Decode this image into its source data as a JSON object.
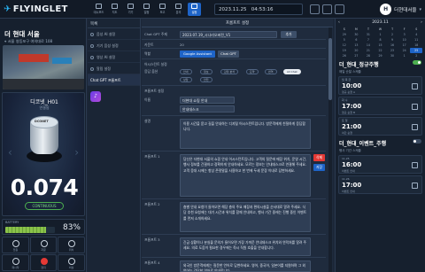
{
  "header": {
    "logo": "FLYINGLET",
    "nav": [
      "대시보드",
      "지도",
      "기기",
      "일정",
      "보고",
      "분석",
      "설정",
      "알림"
    ],
    "date": "2023.11.25",
    "time": "04:53:16",
    "user_name": "더현대서울",
    "avatar_letter": "H"
  },
  "site": {
    "title": "더 현대 서울",
    "address": "서울 영등포구 여의대로 108"
  },
  "device": {
    "name": "디코넷_H01",
    "state": "연결됨",
    "cap_label": "DCONET",
    "value": "0.074",
    "button": "CONTINUOUS",
    "battery_label": "BATTERY",
    "battery_pct": "83%",
    "battery_level": 0.83,
    "controls": [
      "전원",
      "지문",
      "위치",
      "재시작",
      "정지",
      "비상"
    ]
  },
  "menu": {
    "head": "목록",
    "items": [
      "음성 AI 설정",
      "기기 음성 설정",
      "영상 AI 설정",
      "알림 설정"
    ],
    "gpt_label": "Chat GPT 프롬프트"
  },
  "form": {
    "title": "프롬프트 설정",
    "rows": {
      "project_label": "Chat GPT 주제",
      "project_value": "2023.07.19_시나리오버전_V1",
      "project_btn": "추가",
      "count_label": "카운트",
      "count_value": "20",
      "assist_label": "역할",
      "assist_btn": "Google Assistant",
      "assist_btn2": "Chat GPT",
      "group_label": "어시스턴트 설정",
      "option_label": "응답 옵션",
      "chips": [
        "안내",
        "정보",
        "감정 분석",
        "요약",
        "번역",
        "상담",
        "안전",
        "All Chat"
      ],
      "active_chip": "All Chat",
      "section2_label": "프롬프트 설정",
      "name_label": "이름",
      "name_value": "더현대 쇼핑 안내",
      "name_value2": "안내데스크",
      "desc_label": "설명",
      "desc_text": "이용 시간을 묻고 길을 안내하는 디지털 어시스턴트입니다. 방문객에게 친절하게 응답합니다.",
      "prompt1_label": "프롬프트 1",
      "prompt1_text": "당신은 더현대 서울의 쇼핑 안내 어시스턴트입니다. 고객의 질문에 매장 위치, 운영 시간, 행사 정보를 간결하고 정확하게 안내하세요. 모르는 정보는 안내데스크로 연결해 주세요. 고객 응대 시에는 항상 존댓말을 사용하고 한 번에 두세 문장 이내로 답변하세요.",
      "btn_delete": "삭제",
      "btn_save": "저장",
      "prompt2_label": "프롬프트 2",
      "prompt2_text": "층별 안내 요청이 들어오면 해당 층의 주요 매장과 편의시설을 순서대로 알려 주세요. 식당 추천 요청에는 대기 시간과 위치를 함께 안내하고, 행사 기간 중에는 진행 중인 이벤트를 먼저 소개하세요.",
      "prompt3_label": "프롬프트 3",
      "prompt3_text": "긴급 상황이나 분실물 문의가 들어오면 가장 가까운 안내데스크 위치와 연락처를 알려 주세요. 의료 도움이 필요한 경우에는 즉시 직원 호출을 안내합니다.",
      "prompt4_label": "프롬프트 4",
      "prompt4_text": "외국인 방문객에게는 질문한 언어로 답변하세요. 영어, 중국어, 일본어를 지원하며 그 외 언어는 간단한 영어로 안내합니다."
    }
  },
  "calendar": {
    "month": "2023.11",
    "weekdays": [
      "S",
      "M",
      "T",
      "W",
      "T",
      "F",
      "S"
    ],
    "days": [
      "29",
      "30",
      "31",
      "1",
      "2",
      "3",
      "4",
      "5",
      "6",
      "7",
      "8",
      "9",
      "10",
      "11",
      "12",
      "13",
      "14",
      "15",
      "16",
      "17",
      "18",
      "19",
      "20",
      "21",
      "22",
      "23",
      "24",
      "25",
      "26",
      "27",
      "28",
      "29",
      "30",
      "1",
      "2"
    ],
    "today": "25"
  },
  "events": [
    {
      "title": "더_현대_정규주행",
      "sub": "매일 순찰 스케줄",
      "on": true,
      "slots": [
        {
          "day": "월 목 금",
          "time": "10:00",
          "name": "정규 순찰 A"
        },
        {
          "day": "화 수",
          "time": "17:00",
          "name": "정규 순찰 B"
        },
        {
          "day": "토 일",
          "time": "21:00",
          "name": "야간 순찰"
        }
      ]
    },
    {
      "title": "더_현대_이벤트_주행",
      "sub": "행사 기간 스케줄",
      "on": false,
      "slots": [
        {
          "day": "11.25",
          "time": "16:00",
          "name": "이벤트 안내"
        },
        {
          "day": "11.26",
          "time": "17:00",
          "name": "이벤트 안내"
        }
      ]
    }
  ]
}
